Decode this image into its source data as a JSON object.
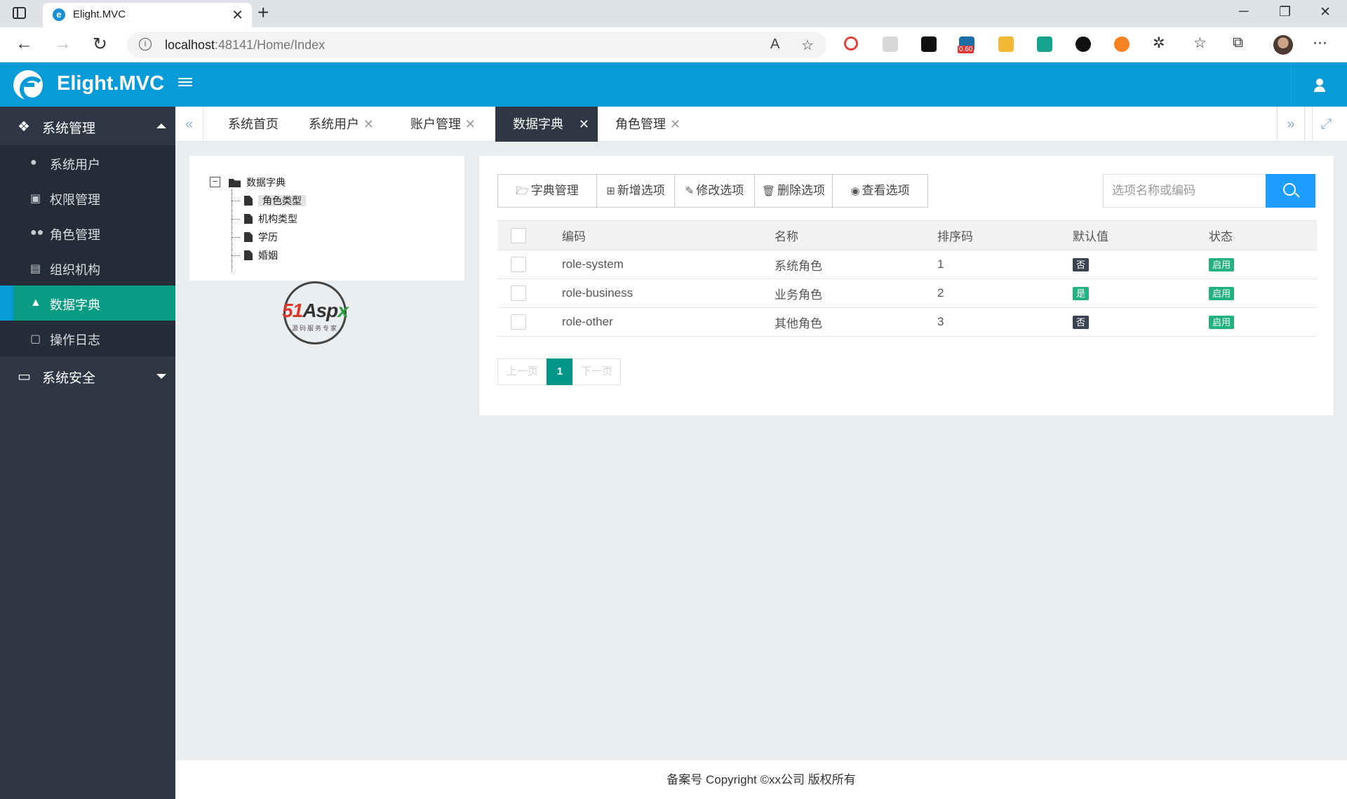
{
  "browser": {
    "tab_title": "Elight.MVC",
    "tab_favicon": "e",
    "url_host": "localhost",
    "url_rest": ":48141/Home/Index",
    "extension_badge": "0.60"
  },
  "app": {
    "logo_text": "Elight.MVC"
  },
  "sidebar": {
    "groups": [
      {
        "label": "系统管理",
        "icon": "cubes-icon",
        "expanded": true
      },
      {
        "label": "系统安全",
        "icon": "monitor-icon",
        "expanded": false
      }
    ],
    "items": [
      {
        "label": "系统用户",
        "icon": "user-icon"
      },
      {
        "label": "权限管理",
        "icon": "briefcase-icon"
      },
      {
        "label": "角色管理",
        "icon": "users-icon"
      },
      {
        "label": "组织机构",
        "icon": "building-icon"
      },
      {
        "label": "数据字典",
        "icon": "sitemap-icon",
        "active": true
      },
      {
        "label": "操作日志",
        "icon": "save-icon"
      }
    ]
  },
  "page_tabs": [
    {
      "label": "系统首页",
      "closable": false
    },
    {
      "label": "系统用户",
      "closable": true
    },
    {
      "label": "账户管理",
      "closable": true
    },
    {
      "label": "数据字典",
      "closable": true,
      "active": true
    },
    {
      "label": "角色管理",
      "closable": true
    }
  ],
  "tree": {
    "root": "数据字典",
    "children": [
      "角色类型",
      "机构类型",
      "学历",
      "婚姻"
    ],
    "selected": "角色类型"
  },
  "watermark": {
    "text_a": "5",
    "text_b": "1",
    "text_c": "Asp",
    "text_d": "x",
    "sub": "源码服务专家"
  },
  "toolbar": {
    "buttons": [
      {
        "label": "字典管理",
        "icon": "folder-open-icon"
      },
      {
        "label": "新增选项",
        "icon": "plus-square-icon"
      },
      {
        "label": "修改选项",
        "icon": "edit-icon"
      },
      {
        "label": "删除选项",
        "icon": "trash-icon"
      },
      {
        "label": "查看选项",
        "icon": "eye-icon"
      }
    ],
    "search_placeholder": "选项名称或编码"
  },
  "grid": {
    "columns": [
      "编码",
      "名称",
      "排序码",
      "默认值",
      "状态"
    ],
    "rows": [
      {
        "code": "role-system",
        "name": "系统角色",
        "sort": "1",
        "default": "否",
        "status": "启用"
      },
      {
        "code": "role-business",
        "name": "业务角色",
        "sort": "2",
        "default": "是",
        "status": "启用"
      },
      {
        "code": "role-other",
        "name": "其他角色",
        "sort": "3",
        "default": "否",
        "status": "启用"
      }
    ]
  },
  "pager": {
    "prev": "上一页",
    "current": "1",
    "next": "下一页"
  },
  "footer": {
    "text": "备案号 Copyright ©xx公司 版权所有"
  }
}
